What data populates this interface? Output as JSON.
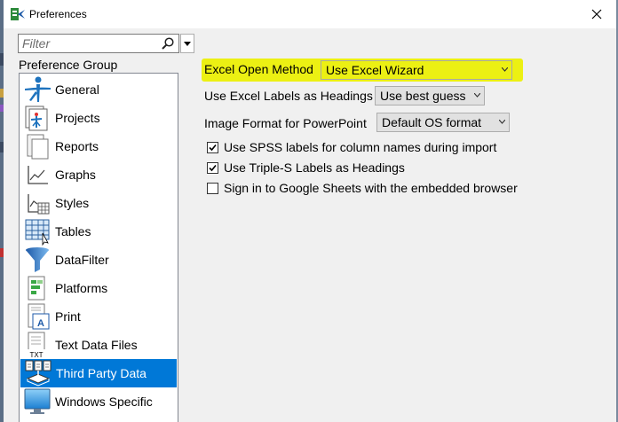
{
  "window": {
    "title": "Preferences",
    "close_glyph": "✕"
  },
  "filter": {
    "placeholder": "Filter",
    "icon": "search-icon",
    "dropdown_icon": "chevron-down-icon"
  },
  "preference_group": {
    "label": "Preference Group",
    "items": [
      {
        "label": "General",
        "icon": "general-icon"
      },
      {
        "label": "Projects",
        "icon": "projects-icon"
      },
      {
        "label": "Reports",
        "icon": "reports-icon"
      },
      {
        "label": "Graphs",
        "icon": "graphs-icon"
      },
      {
        "label": "Styles",
        "icon": "styles-icon"
      },
      {
        "label": "Tables",
        "icon": "tables-icon"
      },
      {
        "label": "DataFilter",
        "icon": "datafilter-icon"
      },
      {
        "label": "Platforms",
        "icon": "platforms-icon"
      },
      {
        "label": "Print",
        "icon": "print-icon"
      },
      {
        "label": "Text Data Files",
        "icon": "text-data-files-icon",
        "icon_text": "TXT"
      },
      {
        "label": "Third Party Data",
        "icon": "third-party-data-icon",
        "selected": true
      },
      {
        "label": "Windows Specific",
        "icon": "windows-specific-icon"
      }
    ]
  },
  "settings": {
    "excel_open_method": {
      "label": "Excel Open Method",
      "value": "Use Excel Wizard"
    },
    "excel_labels_headings": {
      "label": "Use Excel Labels as Headings",
      "value": "Use best guess"
    },
    "image_format": {
      "label": "Image Format for PowerPoint",
      "value": "Default OS format"
    },
    "checkboxes": [
      {
        "label": "Use SPSS labels for column names during import",
        "checked": true
      },
      {
        "label": "Use Triple-S Labels as Headings",
        "checked": true
      },
      {
        "label": "Sign in to Google Sheets with the embedded browser",
        "checked": false
      }
    ]
  },
  "colors": {
    "accent": "#0078d7",
    "highlight": "#ecf000",
    "combo_bg": "#e1e1e1",
    "dialog_bg": "#f0f0f0"
  }
}
